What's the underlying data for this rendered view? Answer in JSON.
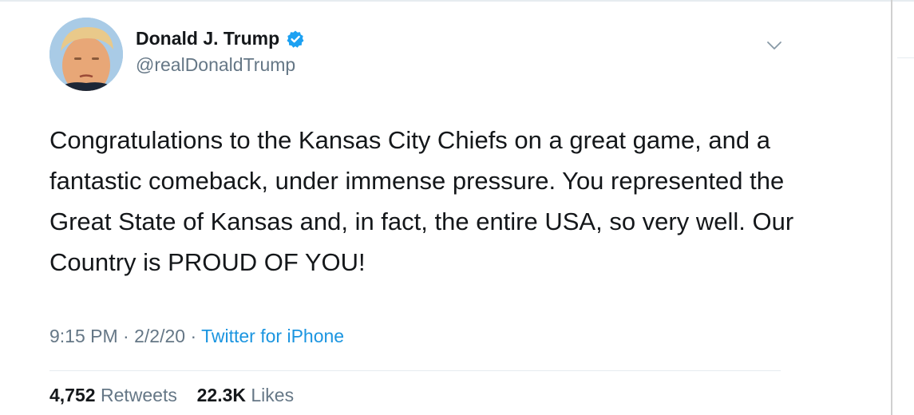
{
  "user": {
    "display_name": "Donald J. Trump",
    "handle": "@realDonaldTrump",
    "verified_icon": "verified-badge-icon",
    "avatar_icon": "profile-photo"
  },
  "tweet": {
    "text": "Congratulations to the Kansas City Chiefs on a great game, and a fantastic comeback, under immense pressure. You represented the Great State of Kansas and, in fact, the entire USA, so very well. Our Country is PROUD OF YOU!",
    "time": "9:15 PM",
    "separator1": "·",
    "date": "2/2/20",
    "separator2": "·",
    "source": "Twitter for iPhone"
  },
  "stats": {
    "retweets_count": "4,752",
    "retweets_label": "Retweets",
    "likes_count": "22.3K",
    "likes_label": "Likes"
  },
  "colors": {
    "text": "#14171a",
    "secondary": "#657786",
    "link": "#1b95e0",
    "verified": "#1da1f2"
  }
}
